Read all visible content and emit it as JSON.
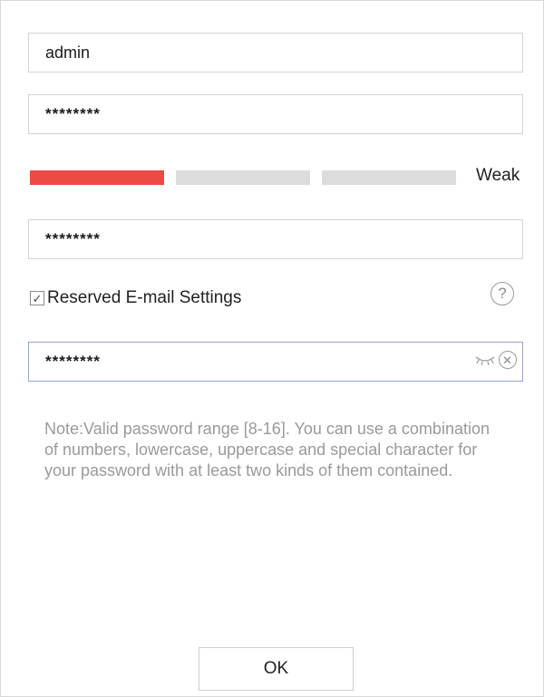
{
  "form": {
    "username_value": "admin",
    "password_value": "********",
    "password_strength": {
      "label": "Weak",
      "level": 1,
      "max_level": 3,
      "active_color": "#ec4a45",
      "inactive_color": "#dcdcdc"
    },
    "confirm_password_value": "********",
    "reserved_email": {
      "checked": true,
      "label": "Reserved E-mail Settings",
      "check_glyph": "✓"
    },
    "email_password_value": "********",
    "help_icon_glyph": "?",
    "clear_icon_glyph": "✕",
    "note": "Note:Valid password range [8-16]. You can use a combination of numbers, lowercase, uppercase and special character for your password with at least two kinds of them contained.",
    "ok_label": "OK"
  },
  "icons": {
    "help": "question-circle-icon",
    "show_password": "eye-closed-icon",
    "clear": "clear-circle-icon"
  }
}
